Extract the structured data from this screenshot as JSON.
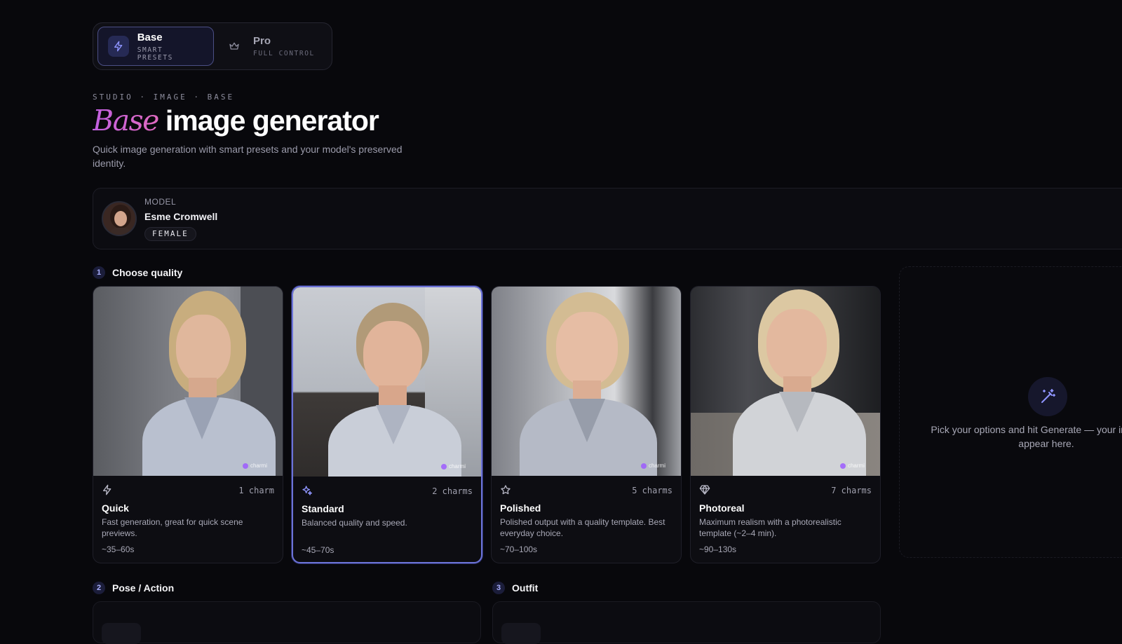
{
  "mode_switch": {
    "tabs": [
      {
        "title": "Base",
        "subtitle": "SMART PRESETS",
        "icon": "bolt-icon",
        "active": true
      },
      {
        "title": "Pro",
        "subtitle": "FULL CONTROL",
        "icon": "crown-icon",
        "active": false
      }
    ]
  },
  "header": {
    "eyebrow": "STUDIO · IMAGE · BASE",
    "title_accent": "Base",
    "title_rest": "image generator",
    "subtitle": "Quick image generation with smart presets and your model's preserved identity."
  },
  "model": {
    "label": "MODEL",
    "name": "Esme Cromwell",
    "badge": "FEMALE"
  },
  "quality": {
    "step": "1",
    "title": "Choose quality",
    "options": [
      {
        "name": "Quick",
        "cost": "1 charm",
        "desc": "Fast generation, great for quick scene previews.",
        "time": "~35–60s",
        "icon": "bolt-icon",
        "selected": false,
        "watermark": "charmi"
      },
      {
        "name": "Standard",
        "cost": "2 charms",
        "desc": "Balanced quality and speed.",
        "time": "~45–70s",
        "icon": "sparkles-icon",
        "selected": true,
        "watermark": "charmi"
      },
      {
        "name": "Polished",
        "cost": "5 charms",
        "desc": "Polished output with a quality template. Best everyday choice.",
        "time": "~70–100s",
        "icon": "star-icon",
        "selected": false,
        "watermark": "charmi"
      },
      {
        "name": "Photoreal",
        "cost": "7 charms",
        "desc": "Maximum realism with a photorealistic template (~2–4 min).",
        "time": "~90–130s",
        "icon": "diamond-icon",
        "selected": false,
        "watermark": "charmi"
      }
    ]
  },
  "pose": {
    "step": "2",
    "title": "Pose / Action"
  },
  "outfit": {
    "step": "3",
    "title": "Outfit"
  },
  "preview": {
    "icon": "magic-wand-icon",
    "text": "Pick your options and hit Generate — your image will appear here."
  },
  "colors": {
    "background": "#08080c",
    "accent": "#6c73d8",
    "accent_gradient": [
      "#c05fe0",
      "#e06ac0"
    ]
  }
}
